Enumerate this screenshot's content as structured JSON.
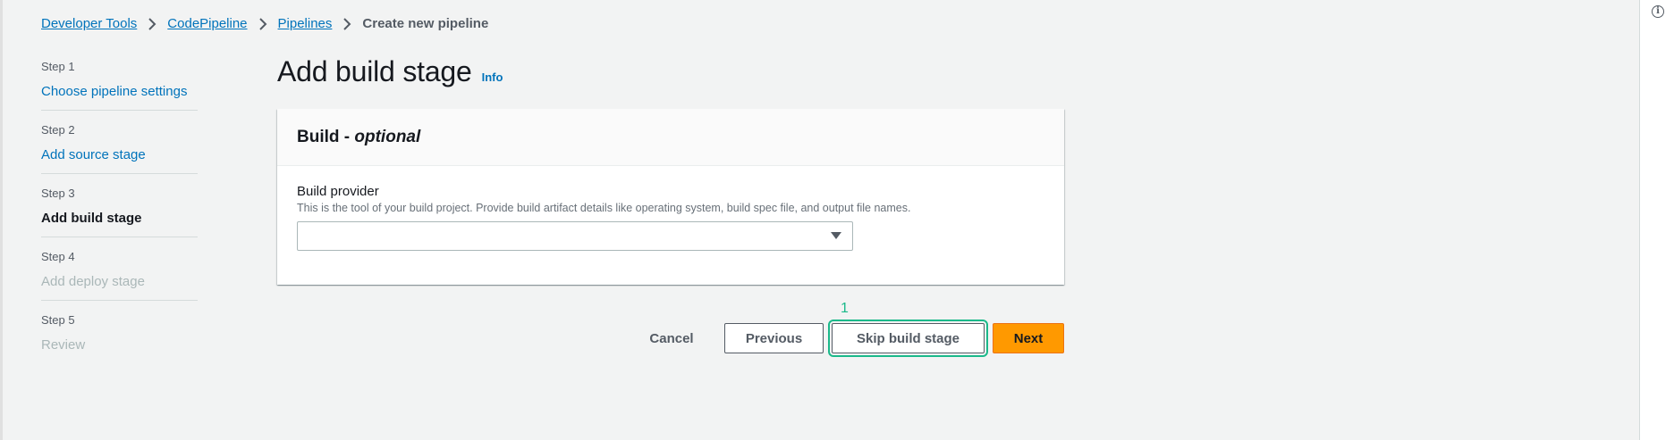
{
  "breadcrumb": {
    "items": [
      {
        "label": "Developer Tools"
      },
      {
        "label": "CodePipeline"
      },
      {
        "label": "Pipelines"
      }
    ],
    "current": "Create new pipeline"
  },
  "steps": [
    {
      "number": "Step 1",
      "label": "Choose pipeline settings",
      "state": "link"
    },
    {
      "number": "Step 2",
      "label": "Add source stage",
      "state": "link"
    },
    {
      "number": "Step 3",
      "label": "Add build stage",
      "state": "current"
    },
    {
      "number": "Step 4",
      "label": "Add deploy stage",
      "state": "disabled"
    },
    {
      "number": "Step 5",
      "label": "Review",
      "state": "disabled"
    }
  ],
  "header": {
    "title": "Add build stage",
    "info_label": "Info"
  },
  "container": {
    "title_prefix": "Build - ",
    "title_optional": "optional",
    "field": {
      "label": "Build provider",
      "description": "This is the tool of your build project. Provide build artifact details like operating system, build spec file, and output file names.",
      "value": ""
    }
  },
  "actions": {
    "marker": "1",
    "cancel_label": "Cancel",
    "previous_label": "Previous",
    "skip_label": "Skip build stage",
    "next_label": "Next"
  },
  "colors": {
    "link": "#0073bb",
    "primary_button": "#ff9900",
    "highlight": "#1bb98a",
    "background": "#f2f3f3"
  },
  "icons": {
    "breadcrumb_separator": "chevron-right-icon",
    "select_caret": "caret-down-icon",
    "tools_panel": "info-circle-icon"
  }
}
